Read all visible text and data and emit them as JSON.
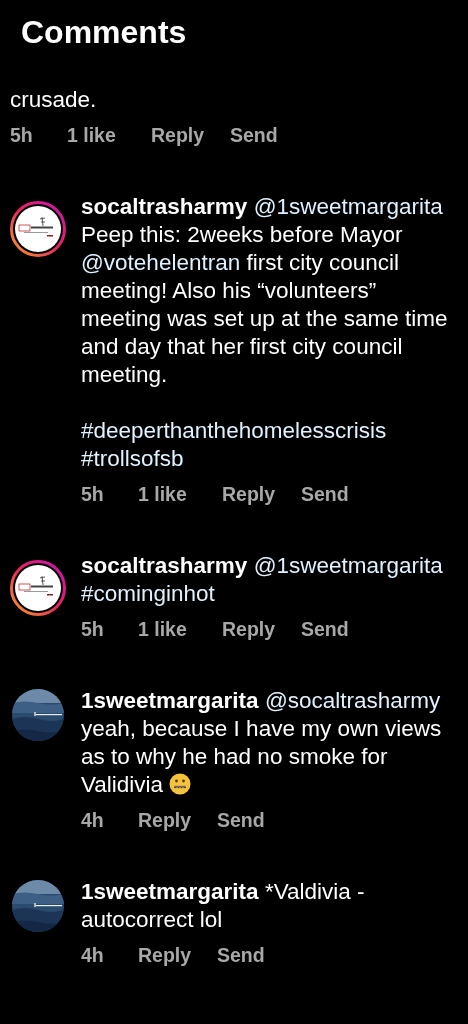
{
  "header": {
    "title": "Comments"
  },
  "top_comment": {
    "body": [
      {
        "kind": "plain",
        "text": "crusade."
      }
    ],
    "time": "5h",
    "likes": "1 like",
    "reply": "Reply",
    "send": "Send"
  },
  "replies": [
    {
      "username": "socaltrasharmy",
      "kind": "logo",
      "story_ring": true,
      "body": [
        {
          "kind": "link",
          "text": "@1sweetmargarita"
        },
        {
          "kind": "plain",
          "text": " Peep this: 2weeks before Mayor "
        },
        {
          "kind": "link",
          "text": "@votehelentran"
        },
        {
          "kind": "plain",
          "text": " first city council meeting! Also his “volunteers” meeting was set up at the same time and day that her first city council meeting."
        },
        {
          "kind": "paragraph_break"
        },
        {
          "kind": "link",
          "text": "#deeperthanthehomelesscrisis"
        },
        {
          "kind": "line_break"
        },
        {
          "kind": "link",
          "text": "#trollsofsb"
        }
      ],
      "time": "5h",
      "likes": "1 like",
      "reply": "Reply",
      "send": "Send"
    },
    {
      "username": "socaltrasharmy",
      "kind": "logo",
      "story_ring": true,
      "body": [
        {
          "kind": "link",
          "text": "@1sweetmargarita"
        },
        {
          "kind": "line_break"
        },
        {
          "kind": "link",
          "text": "#cominginhot"
        }
      ],
      "time": "5h",
      "likes": "1 like",
      "reply": "Reply",
      "send": "Send"
    },
    {
      "username": "1sweetmargarita",
      "story_ring": false,
      "body": [
        {
          "kind": "link",
          "text": "@socaltrasharmy"
        },
        {
          "kind": "plain",
          "text": " yeah, because I have my own views as to why he had no smoke for Validivia "
        },
        {
          "kind": "emoji"
        }
      ],
      "time": "4h",
      "reply": "Reply",
      "send": "Send"
    },
    {
      "username": "1sweetmargarita",
      "story_ring": false,
      "body": [
        {
          "kind": "plain",
          "text": "*Valdivia - autocorrect lol"
        }
      ],
      "time": "4h",
      "reply": "Reply",
      "send": "Send"
    }
  ]
}
